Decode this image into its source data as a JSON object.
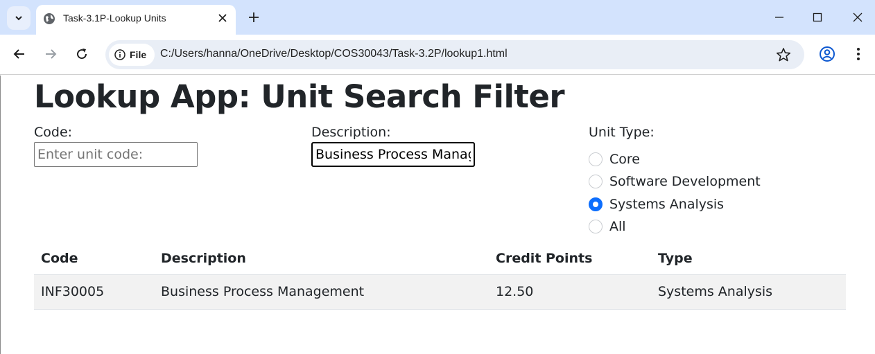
{
  "browser": {
    "tab_title": "Task-3.1P-Lookup Units",
    "site_chip": "File",
    "url": "C:/Users/hanna/OneDrive/Desktop/COS30043/Task-3.2P/lookup1.html"
  },
  "page": {
    "heading": "Lookup App: Unit Search Filter",
    "code_label": "Code:",
    "code_placeholder": "Enter unit code:",
    "code_value": "",
    "description_label": "Description:",
    "description_value": "Business Process Management",
    "unit_type_label": "Unit Type:",
    "unit_types": [
      {
        "label": "Core",
        "checked": false
      },
      {
        "label": "Software Development",
        "checked": false
      },
      {
        "label": "Systems Analysis",
        "checked": true
      },
      {
        "label": "All",
        "checked": false
      }
    ]
  },
  "table": {
    "headers": [
      "Code",
      "Description",
      "Credit Points",
      "Type"
    ],
    "rows": [
      [
        "INF30005",
        "Business Process Management",
        "12.50",
        "Systems Analysis"
      ]
    ]
  },
  "colors": {
    "accent": "#0d6efd",
    "tabbar": "#d3e3fd",
    "row_stripe": "#f2f2f2"
  },
  "icons": {
    "tab_search": "chevron-down-icon",
    "favicon": "globe-icon",
    "close": "close-icon",
    "new_tab": "plus-icon",
    "back": "arrow-left-icon",
    "forward": "arrow-right-icon",
    "reload": "reload-icon",
    "info": "info-icon",
    "bookmark": "star-icon",
    "profile": "profile-icon",
    "menu": "kebab-menu-icon"
  }
}
